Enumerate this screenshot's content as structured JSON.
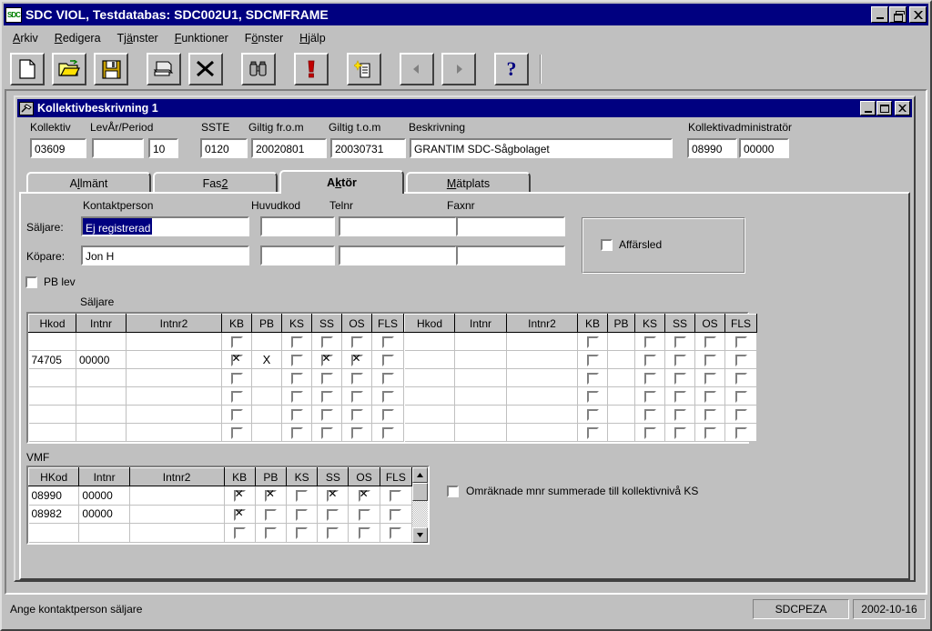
{
  "app": {
    "title": "SDC VIOL, Testdatabas: SDC002U1, SDCMFRAME",
    "icon_label": "SDC",
    "titlebar_color": "#000080"
  },
  "menu": [
    {
      "label": "Arkiv",
      "accel": "A"
    },
    {
      "label": "Redigera",
      "accel": "R"
    },
    {
      "label": "Tjänster",
      "accel": "ä"
    },
    {
      "label": "Funktioner",
      "accel": "F"
    },
    {
      "label": "Fönster",
      "accel": "ö"
    },
    {
      "label": "Hjälp",
      "accel": "H"
    }
  ],
  "toolbar": [
    {
      "name": "new-icon",
      "tip": "Ny"
    },
    {
      "name": "open-folder-icon",
      "tip": "Öppna"
    },
    {
      "name": "save-disk-icon",
      "tip": "Spara"
    },
    {
      "name": "print-icon",
      "tip": "Skriv ut"
    },
    {
      "name": "delete-x-icon",
      "tip": "Ta bort"
    },
    {
      "name": "binoculars-find-icon",
      "tip": "Sök"
    },
    {
      "name": "warning-exclamation-icon",
      "tip": "Meddelande"
    },
    {
      "name": "new-document-sparkle-icon",
      "tip": "Ny post"
    },
    {
      "name": "previous-arrow-icon",
      "tip": "Föregående"
    },
    {
      "name": "next-arrow-icon",
      "tip": "Nästa"
    },
    {
      "name": "help-question-icon",
      "tip": "Hjälp"
    }
  ],
  "mdi": {
    "title": "Kollektivbeskrivning 1",
    "icon_name": "hammer-tool-icon"
  },
  "header_fields": {
    "kollektiv_label": "Kollektiv",
    "kollektiv_value": "03609",
    "levar_period_label": "LevÅr/Period",
    "levar_value": "",
    "period_value": "10",
    "sste_label": "SSTE",
    "sste_value": "0120",
    "giltig_from_label": "Giltig fr.o.m",
    "giltig_from_value": "20020801",
    "giltig_tom_label": "Giltig t.o.m",
    "giltig_tom_value": "20030731",
    "beskrivning_label": "Beskrivning",
    "beskrivning_value": "GRANTIM SDC-Sågbolaget",
    "adm_label": "Kollektivadministratör",
    "adm_value1": "08990",
    "adm_value2": "00000"
  },
  "tabs": [
    {
      "label": "Allmänt",
      "active": false
    },
    {
      "label": "Fas 2",
      "active": false
    },
    {
      "label": "Aktör",
      "active": true
    },
    {
      "label": "Mätplats",
      "active": false
    }
  ],
  "contacts": {
    "col_kontaktperson": "Kontaktperson",
    "col_huvudkod": "Huvudkod",
    "col_telnr": "Telnr",
    "col_faxnr": "Faxnr",
    "saljare_label": "Säljare:",
    "saljare_kontaktperson": "Ej registrerad",
    "saljare_huvudkod": "",
    "saljare_telnr": "",
    "saljare_faxnr": "",
    "kopare_label": "Köpare:",
    "kopare_kontaktperson": "Jon H",
    "kopare_huvudkod": "",
    "kopare_telnr": "",
    "kopare_faxnr": ""
  },
  "affarsled": {
    "checkbox_label": "Affärsled",
    "checked": false
  },
  "pb_lev": {
    "label": "PB lev",
    "checked": false
  },
  "saljare_group_label": "Säljare",
  "grid_left": {
    "columns": [
      "Hkod",
      "Intnr",
      "Intnr2",
      "KB",
      "PB",
      "KS",
      "SS",
      "OS",
      "FLS"
    ],
    "rows": [
      {
        "hkod": "",
        "intnr": "",
        "intnr2": "",
        "kb": false,
        "pb": "",
        "ks": false,
        "ss": false,
        "os": false,
        "fls": false
      },
      {
        "hkod": "74705",
        "intnr": "00000",
        "intnr2": "",
        "kb": true,
        "pb": "X",
        "ks": false,
        "ss": true,
        "os": true,
        "fls": false
      },
      {
        "hkod": "",
        "intnr": "",
        "intnr2": "",
        "kb": false,
        "pb": "",
        "ks": false,
        "ss": false,
        "os": false,
        "fls": false
      },
      {
        "hkod": "",
        "intnr": "",
        "intnr2": "",
        "kb": false,
        "pb": "",
        "ks": false,
        "ss": false,
        "os": false,
        "fls": false
      },
      {
        "hkod": "",
        "intnr": "",
        "intnr2": "",
        "kb": false,
        "pb": "",
        "ks": false,
        "ss": false,
        "os": false,
        "fls": false
      },
      {
        "hkod": "",
        "intnr": "",
        "intnr2": "",
        "kb": false,
        "pb": "",
        "ks": false,
        "ss": false,
        "os": false,
        "fls": false
      }
    ]
  },
  "grid_right": {
    "columns": [
      "Hkod",
      "Intnr",
      "Intnr2",
      "KB",
      "PB",
      "KS",
      "SS",
      "OS",
      "FLS"
    ],
    "rows": [
      {
        "hkod": "",
        "intnr": "",
        "intnr2": "",
        "kb": false,
        "ks": false,
        "ss": false,
        "os": false,
        "fls": false
      },
      {
        "hkod": "",
        "intnr": "",
        "intnr2": "",
        "kb": false,
        "ks": false,
        "ss": false,
        "os": false,
        "fls": false
      },
      {
        "hkod": "",
        "intnr": "",
        "intnr2": "",
        "kb": false,
        "ks": false,
        "ss": false,
        "os": false,
        "fls": false
      },
      {
        "hkod": "",
        "intnr": "",
        "intnr2": "",
        "kb": false,
        "ks": false,
        "ss": false,
        "os": false,
        "fls": false
      },
      {
        "hkod": "",
        "intnr": "",
        "intnr2": "",
        "kb": false,
        "ks": false,
        "ss": false,
        "os": false,
        "fls": false
      },
      {
        "hkod": "",
        "intnr": "",
        "intnr2": "",
        "kb": false,
        "ks": false,
        "ss": false,
        "os": false,
        "fls": false
      }
    ]
  },
  "vmf": {
    "group_label": "VMF",
    "columns": [
      "HKod",
      "Intnr",
      "Intnr2",
      "KB",
      "PB",
      "KS",
      "SS",
      "OS",
      "FLS"
    ],
    "rows": [
      {
        "hkod": "08990",
        "intnr": "00000",
        "intnr2": "",
        "kb": true,
        "pb": true,
        "ks": false,
        "ss": true,
        "os": true,
        "fls": false
      },
      {
        "hkod": "08982",
        "intnr": "00000",
        "intnr2": "",
        "kb": true,
        "pb": false,
        "ks": false,
        "ss": false,
        "os": false,
        "fls": false
      },
      {
        "hkod": "",
        "intnr": "",
        "intnr2": "",
        "kb": false,
        "pb": false,
        "ks": false,
        "ss": false,
        "os": false,
        "fls": false
      }
    ],
    "omraknade_label": "Omräknade mnr summerade till kollektivnivå KS",
    "omraknade_checked": false
  },
  "statusbar": {
    "message": "Ange kontaktperson säljare",
    "panel_code": "SDCPEZA",
    "panel_date": "2002-10-16"
  }
}
